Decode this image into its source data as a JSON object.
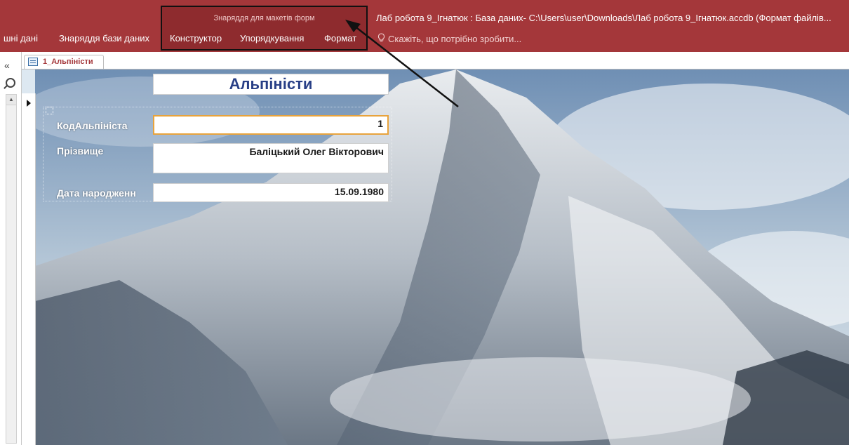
{
  "window": {
    "title": "Лаб робота 9_Ігнатюк : База даних- C:\\Users\\user\\Downloads\\Лаб робота 9_Ігнатюк.accdb (Формат файлів..."
  },
  "ribbon": {
    "context_group_label": "Знаряддя для макетів форм",
    "tabs": [
      {
        "label": "шні дані"
      },
      {
        "label": "Знаряддя бази даних"
      },
      {
        "label": "Конструктор"
      },
      {
        "label": "Упорядкування"
      },
      {
        "label": "Формат"
      }
    ],
    "tell_me_placeholder": "Скажіть, що потрібно зробити...",
    "accent_color": "#a4373a"
  },
  "navpane": {
    "collapse_glyph": "«",
    "scroll_up_glyph": "▲"
  },
  "document": {
    "tab_label": "1_Альпіністи"
  },
  "form": {
    "title": "Альпіністи",
    "fields": [
      {
        "label": "КодАльпініста",
        "value": "1"
      },
      {
        "label": "Прізвище",
        "value": "Баліцький Олег Вікторович"
      },
      {
        "label": "Дата народженн",
        "value": "15.09.1980"
      }
    ],
    "title_color": "#283f86"
  },
  "icons": {
    "tell_me": "lightbulb-icon",
    "doc_tab": "form-icon",
    "nav_search": "search-icon",
    "record_selector": "current-record-icon"
  }
}
